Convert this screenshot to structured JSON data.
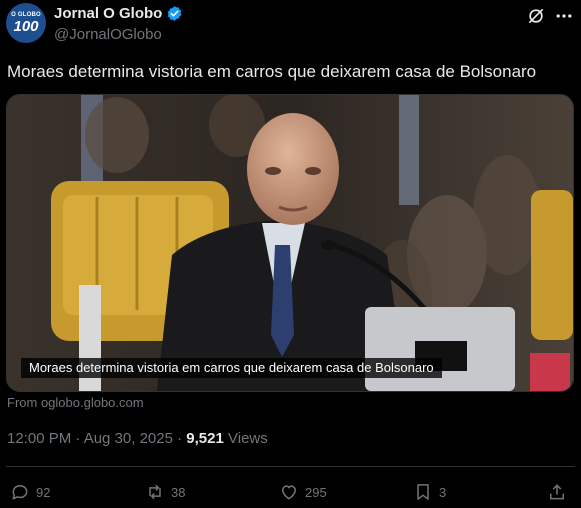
{
  "account": {
    "avatar_brand": "O GLOBO",
    "avatar_number": "100",
    "display_name": "Jornal O Globo",
    "handle": "@JornalOGlobo"
  },
  "tweet": {
    "text": "Moraes determina vistoria em carros que deixarem casa de Bolsonaro",
    "media_caption": "Moraes determina vistoria em carros que deixarem casa de Bolsonaro",
    "source": "From oglobo.globo.com",
    "time": "12:00 PM · Aug 30, 2025 · ",
    "views_count": "9,521",
    "views_label": " Views"
  },
  "actions": {
    "replies": "92",
    "reposts": "38",
    "likes": "295",
    "bookmarks": "3"
  },
  "colors": {
    "background": "#000000",
    "text": "#e7e9ea",
    "muted": "#71767b",
    "verified": "#1d9bf0",
    "divider": "#2f3336"
  }
}
